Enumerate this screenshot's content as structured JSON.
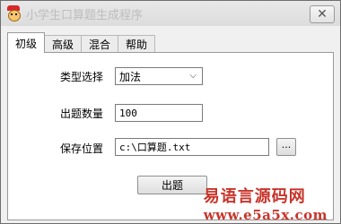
{
  "window": {
    "title": "小学生口算题生成程序",
    "close_symbol": "✕"
  },
  "tabs": [
    {
      "label": "初级",
      "active": true
    },
    {
      "label": "高级",
      "active": false
    },
    {
      "label": "混合",
      "active": false
    },
    {
      "label": "帮助",
      "active": false
    }
  ],
  "form": {
    "type_label": "类型选择",
    "type_value": "加法",
    "count_label": "出题数量",
    "count_value": "100",
    "location_label": "保存位置",
    "location_value": "c:\\口算题.txt",
    "browse_label": "···",
    "generate_label": "出题"
  },
  "watermark": {
    "line1": "易语言源码网",
    "line2": "www.e5a5x.com"
  }
}
